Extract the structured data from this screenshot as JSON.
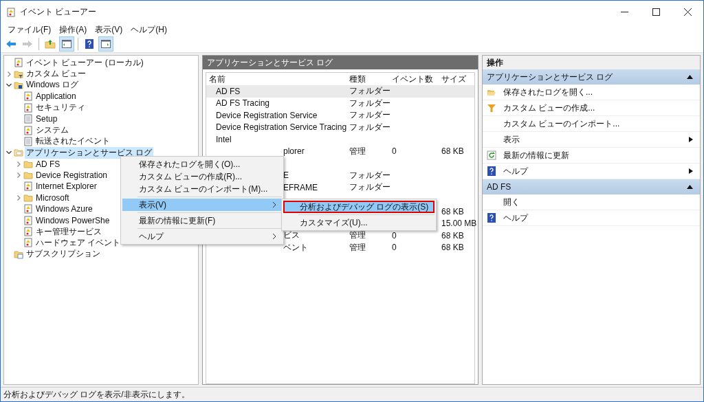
{
  "window": {
    "title": "イベント ビューアー"
  },
  "menu_bar": [
    "ファイル(F)",
    "操作(A)",
    "表示(V)",
    "ヘルプ(H)"
  ],
  "toolbar": [
    {
      "kind": "back",
      "enabled": true,
      "pressed": false
    },
    {
      "kind": "forward",
      "enabled": false,
      "pressed": false
    },
    {
      "kind": "folder-up",
      "enabled": true,
      "pressed": false
    },
    {
      "kind": "pane",
      "enabled": true,
      "pressed": true
    },
    {
      "kind": "help",
      "enabled": true,
      "pressed": false
    },
    {
      "kind": "action-pane",
      "enabled": true,
      "pressed": true
    }
  ],
  "tree": [
    {
      "label": "イベント ビューアー (ローカル)",
      "kind": "viewer",
      "selected": false,
      "children": [
        {
          "label": "カスタム ビュー",
          "kind": "custom",
          "expanded": false,
          "selected": false
        },
        {
          "label": "Windows ログ",
          "kind": "windows",
          "expanded": true,
          "selected": false,
          "children": [
            {
              "label": "Application",
              "kind": "log",
              "selected": false
            },
            {
              "label": "セキュリティ",
              "kind": "log",
              "selected": false
            },
            {
              "label": "Setup",
              "kind": "plain",
              "selected": false
            },
            {
              "label": "システム",
              "kind": "log",
              "selected": false
            },
            {
              "label": "転送されたイベント",
              "kind": "plain",
              "selected": false
            }
          ]
        },
        {
          "label": "アプリケーションとサービス ログ",
          "kind": "open-folder",
          "expanded": true,
          "selected": true,
          "children": [
            {
              "label": "AD FS",
              "kind": "folder",
              "expanded": false,
              "selected": false
            },
            {
              "label": "Device Registration",
              "kind": "folder",
              "expanded": false,
              "selected": false
            },
            {
              "label": "Internet Explorer",
              "kind": "log",
              "selected": false
            },
            {
              "label": "Microsoft",
              "kind": "folder",
              "expanded": false,
              "selected": false
            },
            {
              "label": "Windows Azure",
              "kind": "log",
              "selected": false
            },
            {
              "label": "Windows PowerShe",
              "kind": "log",
              "selected": false
            },
            {
              "label": "キー管理サービス",
              "kind": "log",
              "selected": false
            },
            {
              "label": "ハードウェア イベント",
              "kind": "log",
              "selected": false
            }
          ]
        },
        {
          "label": "サブスクリプション",
          "kind": "subscription",
          "selected": false
        }
      ]
    }
  ],
  "center": {
    "title": "アプリケーションとサービス ログ",
    "columns": [
      "名前",
      "種類",
      "イベント数",
      "サイズ"
    ],
    "rows": [
      {
        "name": "AD FS",
        "type": "フォルダー",
        "selected": true,
        "covered": false
      },
      {
        "name": "AD FS Tracing",
        "type": "フォルダー",
        "selected": false,
        "covered": false
      },
      {
        "name": "Device Registration Service",
        "type": "フォルダー",
        "selected": false,
        "covered": false
      },
      {
        "name": "Device Registration Service Tracing",
        "type": "フォルダー",
        "selected": false,
        "covered": false
      },
      {
        "name": "Intel",
        "selected": false,
        "covered": false
      },
      {
        "name": "plorer",
        "type": "管理",
        "events": "0",
        "size": "68 KB",
        "selected": false,
        "covered": true
      },
      {
        "selected": false
      },
      {
        "name": "E",
        "type": "フォルダー",
        "selected": false,
        "covered": true
      },
      {
        "name": "EFRAME",
        "type": "フォルダー",
        "selected": false,
        "covered": true
      },
      {
        "selected": false
      },
      {
        "size": "68 KB",
        "selected": false
      },
      {
        "size": "15.00 MB",
        "selected": false
      },
      {
        "name": "ビス",
        "type": "管理",
        "events": "0",
        "size": "68 KB",
        "selected": false,
        "covered": true
      },
      {
        "name": "ベント",
        "type": "管理",
        "events": "0",
        "size": "68 KB",
        "selected": false,
        "covered": true
      }
    ]
  },
  "actions": {
    "title": "操作",
    "sections": [
      {
        "title": "アプリケーションとサービス ログ",
        "expanded": true,
        "items": [
          {
            "label": "保存されたログを開く...",
            "kind": "open",
            "submenu": false
          },
          {
            "label": "カスタム ビューの作成...",
            "kind": "filter",
            "submenu": false
          },
          {
            "label": "カスタム ビューのインポート...",
            "submenu": false
          },
          {
            "label": "表示",
            "submenu": true
          },
          {
            "label": "最新の情報に更新",
            "kind": "refresh",
            "submenu": false
          },
          {
            "label": "ヘルプ",
            "kind": "help",
            "submenu": true
          }
        ]
      },
      {
        "title": "AD FS",
        "expanded": true,
        "items": [
          {
            "label": "開く",
            "submenu": false
          },
          {
            "label": "ヘルプ",
            "kind": "help",
            "submenu": false
          }
        ]
      }
    ]
  },
  "context_menu": {
    "items": [
      {
        "kind": "item",
        "label": "保存されたログを開く(O)...",
        "submenu": false,
        "selected": false
      },
      {
        "kind": "item",
        "label": "カスタム ビューの作成(R)...",
        "submenu": false,
        "selected": false
      },
      {
        "kind": "item",
        "label": "カスタム ビューのインポート(M)...",
        "submenu": false,
        "selected": false
      },
      {
        "kind": "separator"
      },
      {
        "kind": "item",
        "label": "表示(V)",
        "submenu": true,
        "selected": true
      },
      {
        "kind": "separator"
      },
      {
        "kind": "item",
        "label": "最新の情報に更新(F)",
        "submenu": false,
        "selected": false
      },
      {
        "kind": "separator"
      },
      {
        "kind": "item",
        "label": "ヘルプ",
        "submenu": true,
        "selected": false
      }
    ]
  },
  "submenu": {
    "items": [
      {
        "kind": "item",
        "label": "分析およびデバッグ ログの表示(S)",
        "selected": true,
        "outlined": true
      },
      {
        "kind": "separator"
      },
      {
        "kind": "item",
        "label": "カスタマイズ(U)...",
        "selected": false,
        "outlined": false
      }
    ]
  },
  "status_bar": "分析およびデバッグ ログを表示/非表示にします。"
}
